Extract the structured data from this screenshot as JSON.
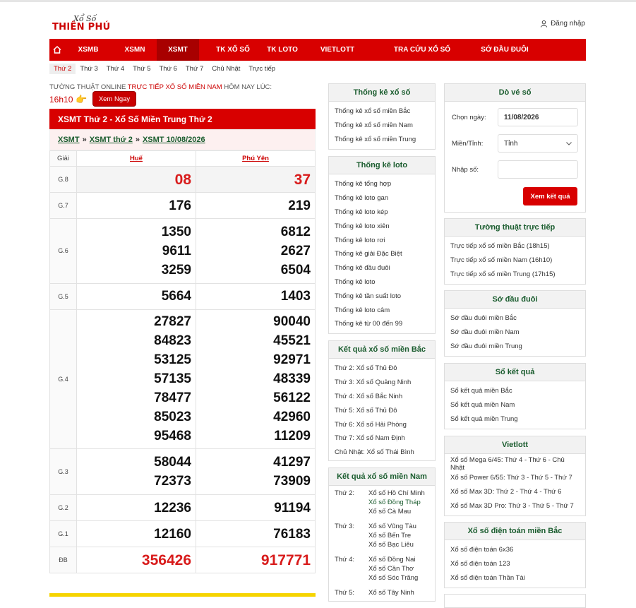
{
  "logo": {
    "line1": "Xổ Số",
    "line2": "THIÊN PHÚ"
  },
  "login_label": "Đăng nhập",
  "nav": {
    "items": [
      "XSMB",
      "XSMN",
      "XSMT",
      "TK XỔ SỐ",
      "TK LOTO",
      "VIETLOTT",
      "TRA CỨU XỔ SỐ",
      "SỚ ĐẦU ĐUÔI"
    ],
    "active": "XSMT"
  },
  "day_tabs": [
    "Thứ 2",
    "Thứ 3",
    "Thứ 4",
    "Thứ 5",
    "Thứ 6",
    "Thứ 7",
    "Chủ Nhật",
    "Trực tiếp"
  ],
  "live": {
    "prefix": "TƯỜNG THUẬT ONLINE",
    "link": "TRỰC TIẾP XỔ SỐ MIỀN NAM",
    "suffix": "HÔM NAY LÚC:",
    "time": "16h10",
    "button": "Xem Ngay"
  },
  "result": {
    "title": "XSMT Thứ 2 - Xổ Số Miền Trung Thứ 2",
    "breadcrumb": [
      "XSMT",
      "XSMT thứ 2",
      "XSMT 10/08/2026"
    ],
    "col_label": "Giải",
    "provinces": [
      "Huế",
      "Phú Yên"
    ],
    "rows": [
      {
        "label": "G.8",
        "a": [
          "08"
        ],
        "b": [
          "37"
        ]
      },
      {
        "label": "G.7",
        "a": [
          "176"
        ],
        "b": [
          "219"
        ]
      },
      {
        "label": "G.6",
        "a": [
          "1350",
          "9611",
          "3259"
        ],
        "b": [
          "6812",
          "2627",
          "6504"
        ]
      },
      {
        "label": "G.5",
        "a": [
          "5664"
        ],
        "b": [
          "1403"
        ]
      },
      {
        "label": "G.4",
        "a": [
          "27827",
          "84823",
          "53125",
          "57135",
          "78477",
          "85023",
          "95468"
        ],
        "b": [
          "90040",
          "45521",
          "92971",
          "48339",
          "56122",
          "42960",
          "11209"
        ]
      },
      {
        "label": "G.3",
        "a": [
          "58044",
          "72373"
        ],
        "b": [
          "41297",
          "73909"
        ]
      },
      {
        "label": "G.2",
        "a": [
          "12236"
        ],
        "b": [
          "91194"
        ]
      },
      {
        "label": "G.1",
        "a": [
          "12160"
        ],
        "b": [
          "76183"
        ]
      },
      {
        "label": "ĐB",
        "a": [
          "356426"
        ],
        "b": [
          "917771"
        ]
      }
    ]
  },
  "tk_xoso": {
    "title": "Thống kê xổ số",
    "items": [
      "Thống kê xổ số miền Bắc",
      "Thống kê xổ số miền Nam",
      "Thống kê xổ số miền Trung"
    ]
  },
  "tk_loto": {
    "title": "Thống kê loto",
    "items": [
      "Thống kê tổng hợp",
      "Thống kê loto gan",
      "Thống kê loto kép",
      "Thống kê loto xiên",
      "Thống kê loto rơi",
      "Thống kê giải Đặc Biệt",
      "Thống kê đầu đuôi",
      "Thống kê loto",
      "Thống kê tần suất loto",
      "Thống kê loto câm",
      "Thống kê từ 00 đến 99"
    ]
  },
  "kq_mb": {
    "title": "Kết quả xổ số miền Bắc",
    "items": [
      "Thứ 2: Xổ số Thủ Đô",
      "Thứ 3: Xổ số Quảng Ninh",
      "Thứ 4: Xổ số Bắc Ninh",
      "Thứ 5: Xổ số Thủ Đô",
      "Thứ 6: Xổ số Hải Phòng",
      "Thứ 7: Xổ số Nam Định",
      "Chủ Nhật: Xổ số Thái Bình"
    ]
  },
  "kq_mn": {
    "title": "Kết quả xổ số miền Nam",
    "days": [
      {
        "day": "Thứ 2:",
        "provinces": [
          "Xổ số Hồ Chí Minh",
          "Xổ số Đồng Tháp",
          "Xổ số Cà Mau"
        ]
      },
      {
        "day": "Thứ 3:",
        "provinces": [
          "Xổ số Vũng Tàu",
          "Xổ số Bến Tre",
          "Xổ số Bạc Liêu"
        ]
      },
      {
        "day": "Thứ 4:",
        "provinces": [
          "Xổ số Đồng Nai",
          "Xổ số Cần Thơ",
          "Xổ số Sóc Trăng"
        ]
      },
      {
        "day": "Thứ 5:",
        "provinces": [
          "Xổ số Tây Ninh"
        ]
      }
    ]
  },
  "dove": {
    "title": "Dò vé số",
    "date_label": "Chọn ngày:",
    "date_value": "11/08/2026",
    "region_label": "Miền/Tỉnh:",
    "region_value": "Tỉnh",
    "number_label": "Nhập số:",
    "button": "Xem kết quả"
  },
  "tuong_thuat": {
    "title": "Tường thuật trực tiếp",
    "items": [
      "Trực tiếp xổ số miền Bắc (18h15)",
      "Trực tiếp xổ số miền Nam (16h10)",
      "Trực tiếp xổ số miền Trung (17h15)"
    ]
  },
  "so_dau_duoi": {
    "title": "Sớ đầu đuôi",
    "items": [
      "Sớ đầu đuôi miền Bắc",
      "Sớ đầu đuôi miền Nam",
      "Sớ đầu đuôi miền Trung"
    ]
  },
  "so_ket_qua": {
    "title": "Sổ kết quả",
    "items": [
      "Sổ kết quả miền Bắc",
      "Sổ kết quả miền Nam",
      "Sổ kết quả miền Trung"
    ]
  },
  "vietlott": {
    "title": "Vietlott",
    "items": [
      "Xổ số Mega 6/45: Thứ 4 - Thứ 6 - Chủ Nhật",
      "Xổ số Power 6/55: Thứ 3 - Thứ 5 - Thứ 7",
      "Xổ số Max 3D: Thứ 2 - Thứ 4 - Thứ 6",
      "Xổ số Max 3D Pro: Thứ 3 - Thứ 5 - Thứ 7"
    ]
  },
  "dien_toan": {
    "title": "Xổ số điện toán miền Bắc",
    "items": [
      "Xổ số điện toán 6x36",
      "Xổ số điện toán 123",
      "Xổ số điện toán Thần Tài"
    ]
  }
}
